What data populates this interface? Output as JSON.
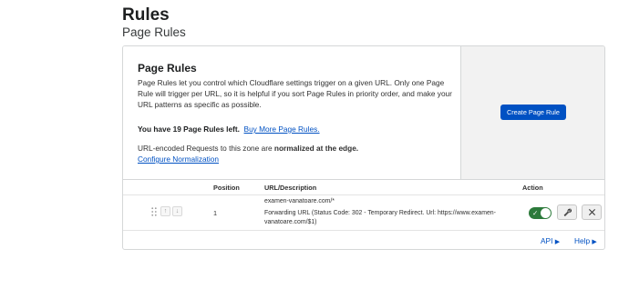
{
  "header": {
    "title": "Rules",
    "subtitle": "Page Rules"
  },
  "info": {
    "title": "Page Rules",
    "description": "Page Rules let you control which Cloudflare settings trigger on a given URL. Only one Page Rule will trigger per URL, so it is helpful if you sort Page Rules in priority order, and make your URL patterns as specific as possible.",
    "remaining_text": "You have 19 Page Rules left.",
    "buy_more_label": "Buy More Page Rules.",
    "normalize_prefix": "URL-encoded Requests to this zone are ",
    "normalize_bold": "normalized at the edge.",
    "configure_label": "Configure Normalization"
  },
  "cta": {
    "create_label": "Create Page Rule"
  },
  "table": {
    "headers": {
      "position": "Position",
      "url": "URL/Description",
      "action": "Action"
    },
    "rows": [
      {
        "position": "1",
        "url": "examen-vanatoare.com/*",
        "description": "Forwarding URL (Status Code: 302 - Temporary Redirect. Url: https://www.examen-vanatoare.com/$1)",
        "enabled": true
      }
    ]
  },
  "footer": {
    "api_label": "API",
    "help_label": "Help"
  },
  "colors": {
    "accent": "#0051c3",
    "toggle_on": "#2c7a3b"
  }
}
